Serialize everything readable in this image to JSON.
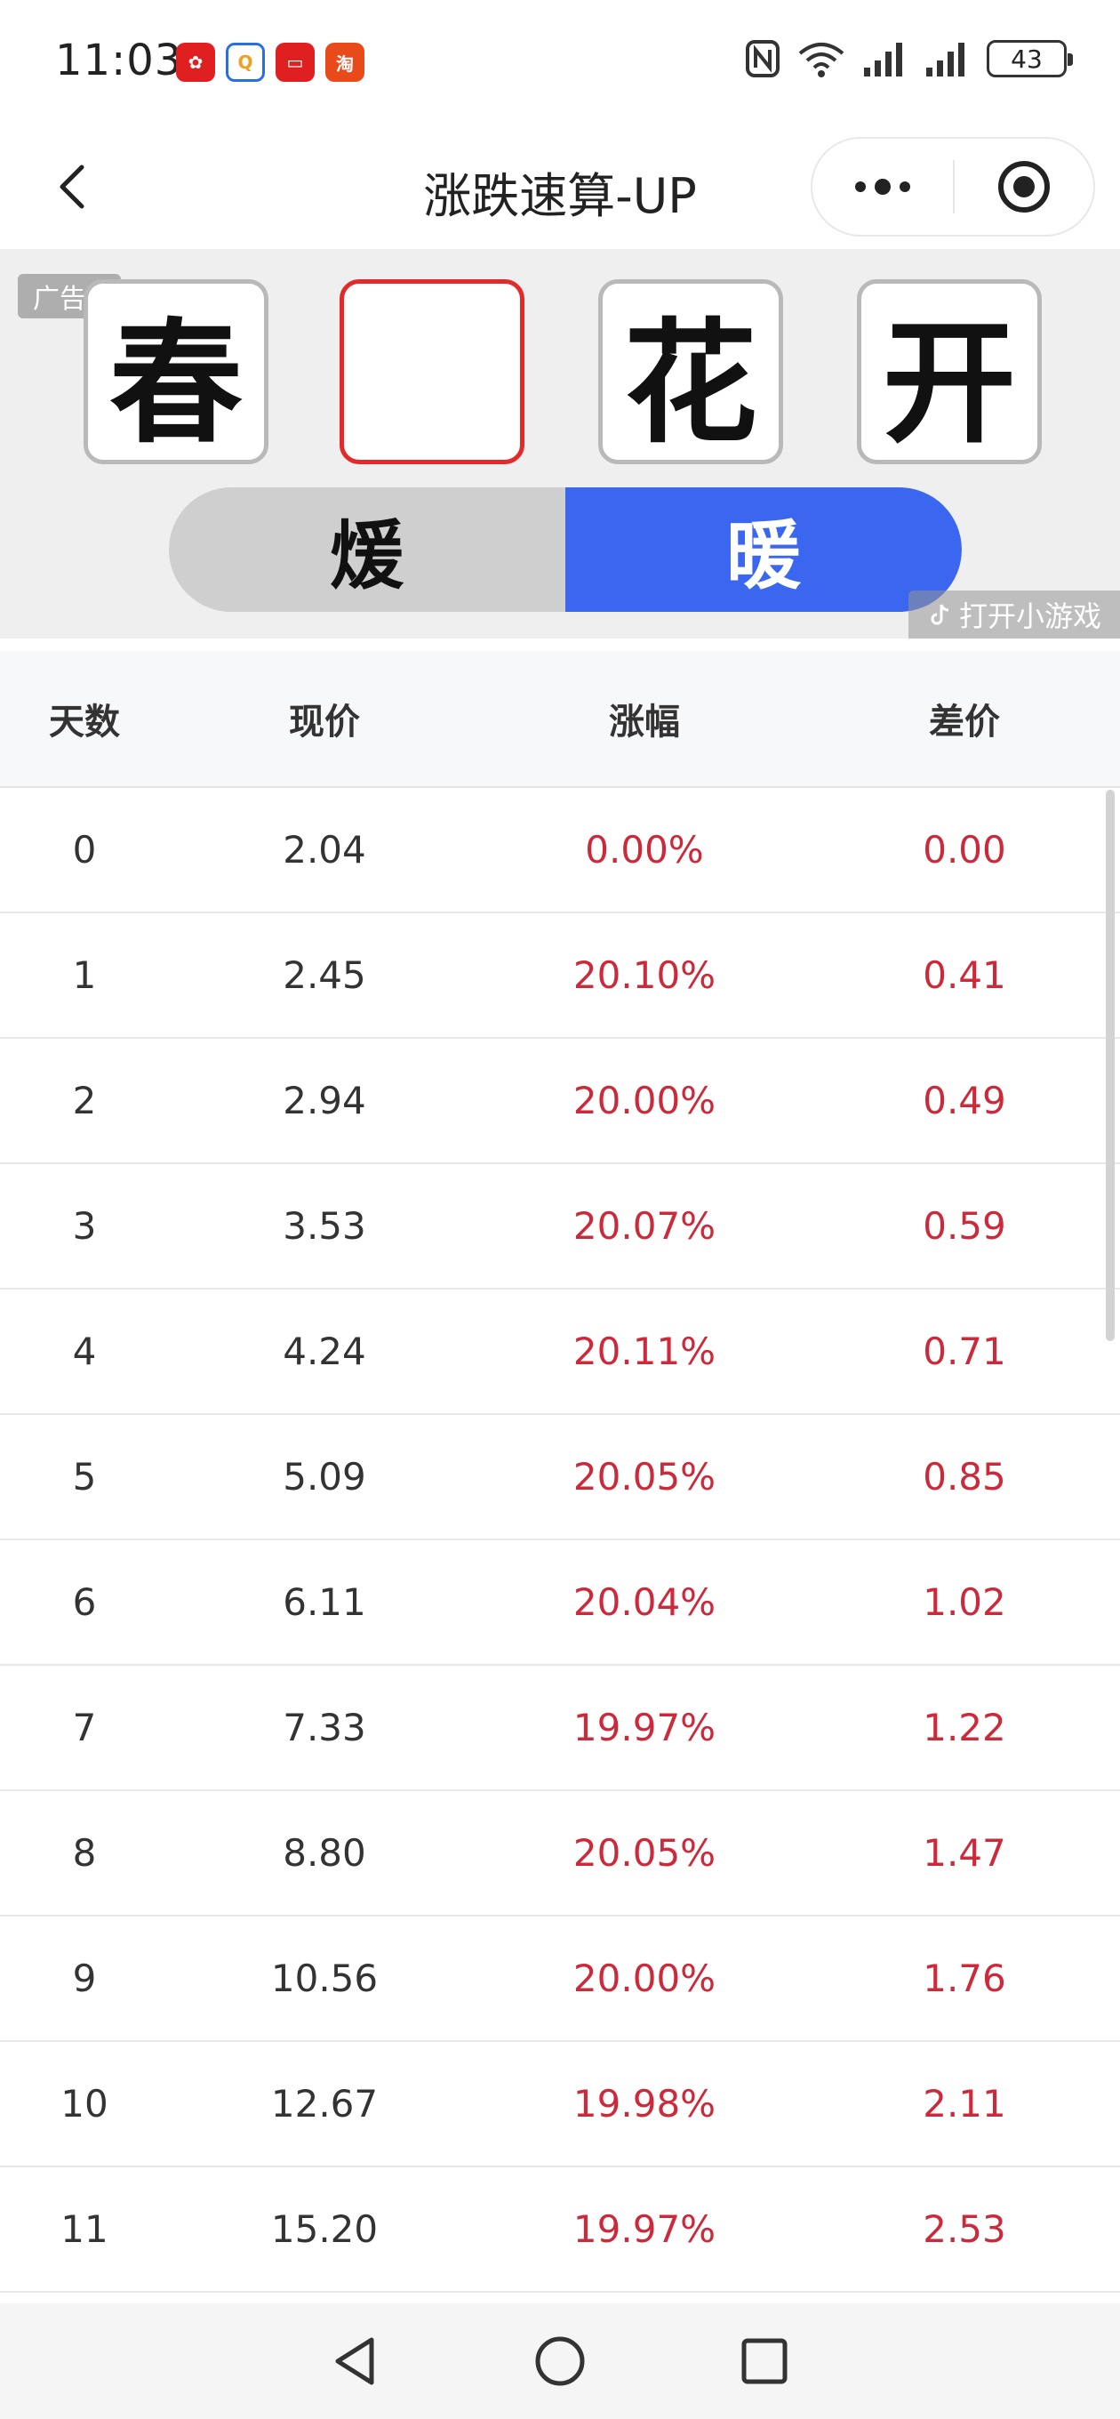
{
  "status_bar": {
    "time": "11:03",
    "battery": "43",
    "notif_colors": [
      "#e02020",
      "#f0a020",
      "#e02020",
      "#e84a1a"
    ]
  },
  "header": {
    "title": "涨跌速算-UP"
  },
  "ad": {
    "tag_label": "广告",
    "tiles": [
      "春",
      "",
      "花",
      "开"
    ],
    "choices": [
      "煖",
      "暖"
    ],
    "selected_choice": 1,
    "open_game_label": "打开小游戏"
  },
  "table": {
    "headers": [
      "天数",
      "现价",
      "涨幅",
      "差价"
    ],
    "rows": [
      {
        "day": "0",
        "price": "2.04",
        "change": "0.00%",
        "diff": "0.00"
      },
      {
        "day": "1",
        "price": "2.45",
        "change": "20.10%",
        "diff": "0.41"
      },
      {
        "day": "2",
        "price": "2.94",
        "change": "20.00%",
        "diff": "0.49"
      },
      {
        "day": "3",
        "price": "3.53",
        "change": "20.07%",
        "diff": "0.59"
      },
      {
        "day": "4",
        "price": "4.24",
        "change": "20.11%",
        "diff": "0.71"
      },
      {
        "day": "5",
        "price": "5.09",
        "change": "20.05%",
        "diff": "0.85"
      },
      {
        "day": "6",
        "price": "6.11",
        "change": "20.04%",
        "diff": "1.02"
      },
      {
        "day": "7",
        "price": "7.33",
        "change": "19.97%",
        "diff": "1.22"
      },
      {
        "day": "8",
        "price": "8.80",
        "change": "20.05%",
        "diff": "1.47"
      },
      {
        "day": "9",
        "price": "10.56",
        "change": "20.00%",
        "diff": "1.76"
      },
      {
        "day": "10",
        "price": "12.67",
        "change": "19.98%",
        "diff": "2.11"
      },
      {
        "day": "11",
        "price": "15.20",
        "change": "19.97%",
        "diff": "2.53"
      }
    ]
  },
  "colors": {
    "up_red": "#cc2a3a",
    "accent_blue": "#3b67f0",
    "empty_tile_border": "#e22a2a"
  }
}
